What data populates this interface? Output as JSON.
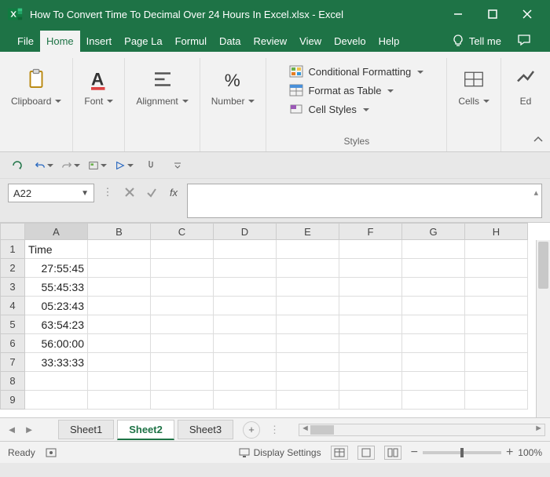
{
  "title": "How To Convert Time To Decimal Over 24 Hours In Excel.xlsx  -  Excel",
  "tabs": {
    "file": "File",
    "home": "Home",
    "insert": "Insert",
    "pagelayout": "Page La",
    "formulas": "Formul",
    "data": "Data",
    "review": "Review",
    "view": "View",
    "developer": "Develo",
    "help": "Help",
    "tellme": "Tell me"
  },
  "ribbon": {
    "clipboard": "Clipboard",
    "font": "Font",
    "alignment": "Alignment",
    "number": "Number",
    "styles_label": "Styles",
    "cf": "Conditional Formatting",
    "fat": "Format as Table",
    "cs": "Cell Styles",
    "cells": "Cells",
    "editing": "Ed"
  },
  "namebox": "A22",
  "fx": "fx",
  "cols": [
    "A",
    "B",
    "C",
    "D",
    "E",
    "F",
    "G",
    "H"
  ],
  "rows": [
    "1",
    "2",
    "3",
    "4",
    "5",
    "6",
    "7",
    "8",
    "9"
  ],
  "cells": {
    "A1": "Time",
    "A2": "27:55:45",
    "A3": "55:45:33",
    "A4": "05:23:43",
    "A5": "63:54:23",
    "A6": "56:00:00",
    "A7": "33:33:33"
  },
  "sheets": {
    "s1": "Sheet1",
    "s2": "Sheet2",
    "s3": "Sheet3"
  },
  "status": {
    "ready": "Ready",
    "display": "Display Settings",
    "zoom": "100%"
  }
}
